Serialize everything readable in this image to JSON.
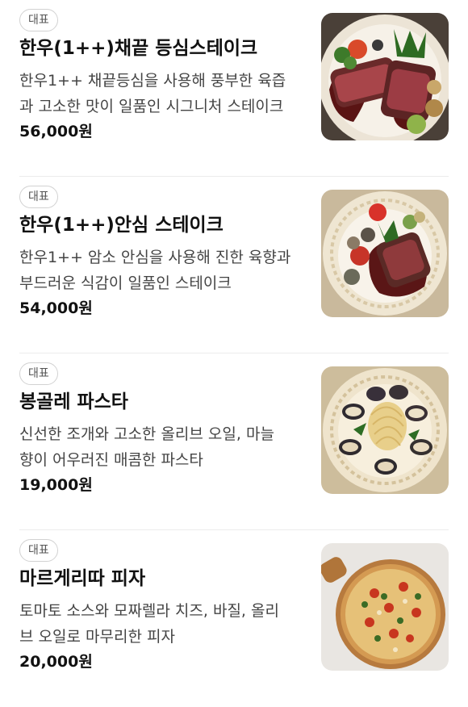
{
  "menu": {
    "items": [
      {
        "badge": "대표",
        "name": "한우(1++)채끝 등심스테이크",
        "desc_line1": "한우1++ 채끝등심을 사용해 풍부한 육즙",
        "desc_line2": "과 고소한 맛이 일품인 시그니처 스테이크",
        "price": "56,000원",
        "image_icon": "steak-plate-image"
      },
      {
        "badge": "대표",
        "name": "한우(1++)안심 스테이크",
        "desc_line1": "한우1++ 암소 안심을 사용해 진한 육향과",
        "desc_line2": "부드러운 식감이 일품인 스테이크",
        "price": "54,000원",
        "image_icon": "tenderloin-plate-image"
      },
      {
        "badge": "대표",
        "name": "봉골레 파스타",
        "desc_line1": "신선한 조개와 고소한 올리브 오일, 마늘",
        "desc_line2": "향이 어우러진 매콤한 파스타",
        "price": "19,000원",
        "image_icon": "clam-pasta-image"
      },
      {
        "badge": "대표",
        "name": "마르게리따 피자",
        "desc_line1": "토마토 소스와 모짜렐라 치즈, 바질, 올리",
        "desc_line2": "브 오일로 마무리한 피자",
        "price": "20,000원",
        "image_icon": "pizza-image"
      }
    ]
  },
  "colors": {
    "text_primary": "#111111",
    "text_secondary": "#444444",
    "badge_border": "#d2d2d2",
    "divider": "#ececec"
  }
}
